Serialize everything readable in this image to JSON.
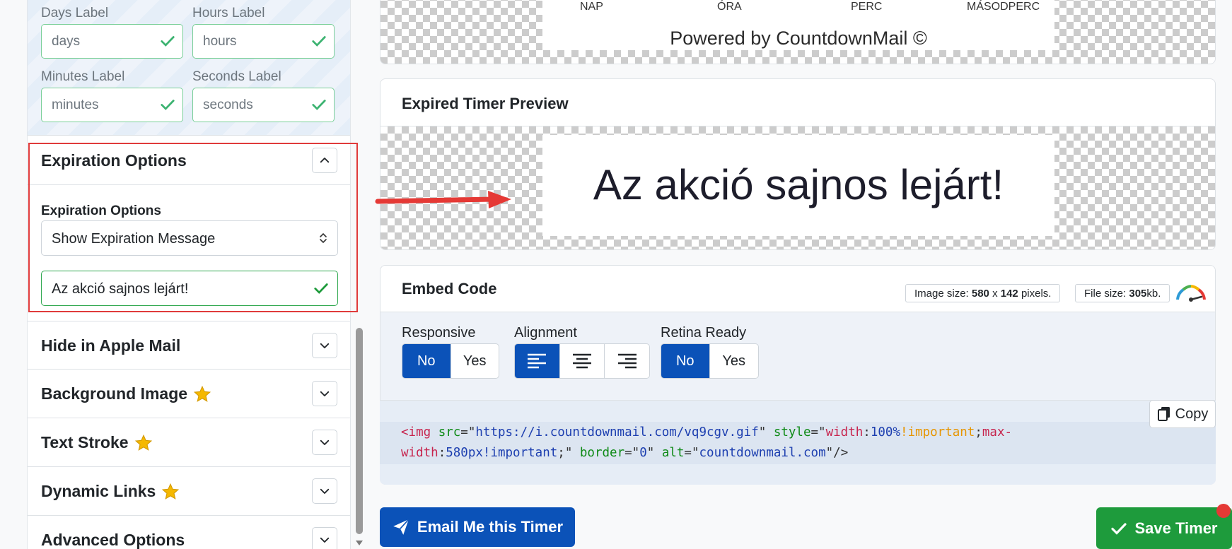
{
  "labels": {
    "days_label": "Days Label",
    "days_value": "days",
    "hours_label": "Hours Label",
    "hours_value": "hours",
    "minutes_label": "Minutes Label",
    "minutes_value": "minutes",
    "seconds_label": "Seconds Label",
    "seconds_value": "seconds"
  },
  "expiration": {
    "section_title": "Expiration Options",
    "field_label": "Expiration Options",
    "selected_option": "Show Expiration Message",
    "message_value": "Az akció sajnos lejárt!"
  },
  "sections": [
    {
      "title": "Hide in Apple Mail",
      "premium": false
    },
    {
      "title": "Background Image",
      "premium": true
    },
    {
      "title": "Text Stroke",
      "premium": true
    },
    {
      "title": "Dynamic Links",
      "premium": true
    },
    {
      "title": "Advanced Options",
      "premium": false
    }
  ],
  "preview": {
    "units": [
      "NAP",
      "ÓRA",
      "PERC",
      "MÁSODPERC"
    ],
    "powered_by": "Powered by CountdownMail ©"
  },
  "expired_preview": {
    "title": "Expired Timer Preview",
    "message": "Az akció sajnos lejárt!"
  },
  "embed": {
    "title": "Embed Code",
    "image_size_prefix": "Image size:",
    "image_width": "580",
    "image_x": "x",
    "image_height": "142",
    "image_size_suffix": "pixels.",
    "file_size_prefix": "File size:",
    "file_size_value": "305",
    "file_size_suffix": "kb.",
    "responsive": {
      "label": "Responsive",
      "options": [
        "No",
        "Yes"
      ],
      "selected": "No"
    },
    "alignment": {
      "label": "Alignment",
      "options": [
        "left",
        "center",
        "right"
      ],
      "selected": "left"
    },
    "retina": {
      "label": "Retina Ready",
      "options": [
        "No",
        "Yes"
      ],
      "selected": "No"
    },
    "copy_label": "Copy",
    "code": {
      "t1": "<img ",
      "a1": "src",
      "e1": "=\"",
      "s1": "https://i.countdownmail.com/vq9cgv.gif",
      "q1": "\" ",
      "a2": "style",
      "e2": "=\"",
      "p1": "width",
      "c1": ":",
      "v1": "100%",
      "imp1": "!important",
      "sc1": ";",
      "p2": "max-",
      "p3": "width",
      "c2": ":",
      "v2": "580px!important",
      "sc2": ";\" ",
      "a3": "border",
      "e3": "=\"",
      "s2": "0",
      "q2": "\" ",
      "a4": "alt",
      "e4": "=\"",
      "s3": "countdownmail.com",
      "t2": "\"/>"
    }
  },
  "actions": {
    "email_button": "Email Me this Timer",
    "save_button": "Save Timer"
  },
  "colors": {
    "primary": "#0b52b8",
    "success": "#1e9b3c",
    "highlight": "#e03b3b",
    "star": "#f5b800"
  }
}
